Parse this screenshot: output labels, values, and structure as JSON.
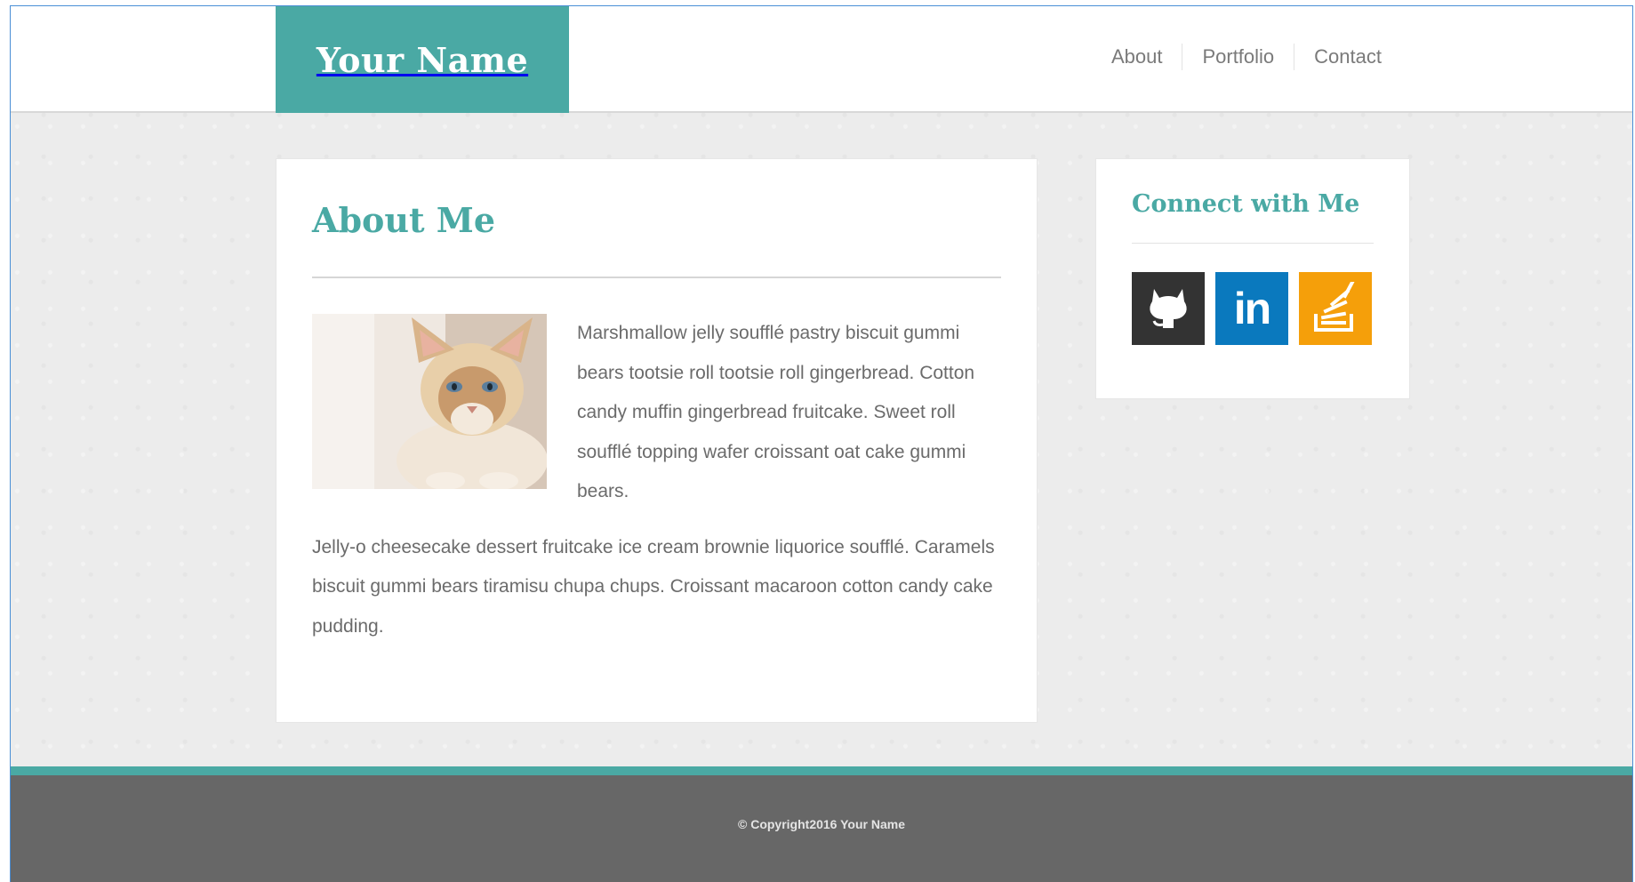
{
  "header": {
    "logo_text": "Your Name",
    "nav": [
      "About",
      "Portfolio",
      "Contact"
    ]
  },
  "main": {
    "title": "About Me",
    "paragraphs": [
      "Marshmallow jelly soufflé pastry biscuit gummi bears tootsie roll tootsie roll gingerbread. Cotton candy muffin gingerbread fruitcake. Sweet roll soufflé topping wafer croissant oat cake gummi bears.",
      "Jelly-o cheesecake dessert fruitcake ice cream brownie liquorice soufflé. Caramels biscuit gummi bears tiramisu chupa chups. Croissant macaroon cotton candy cake pudding."
    ]
  },
  "sidebar": {
    "title": "Connect with Me",
    "social": [
      {
        "icon": "github-icon",
        "color": "#333333"
      },
      {
        "icon": "linkedin-icon",
        "color": "#0a79be",
        "label": "in"
      },
      {
        "icon": "stackoverflow-icon",
        "color": "#f59f0a"
      }
    ]
  },
  "footer": {
    "copyright": "© Copyright2016 Your Name"
  },
  "colors": {
    "accent": "#4aa9a4",
    "footer_bg": "#676767"
  }
}
